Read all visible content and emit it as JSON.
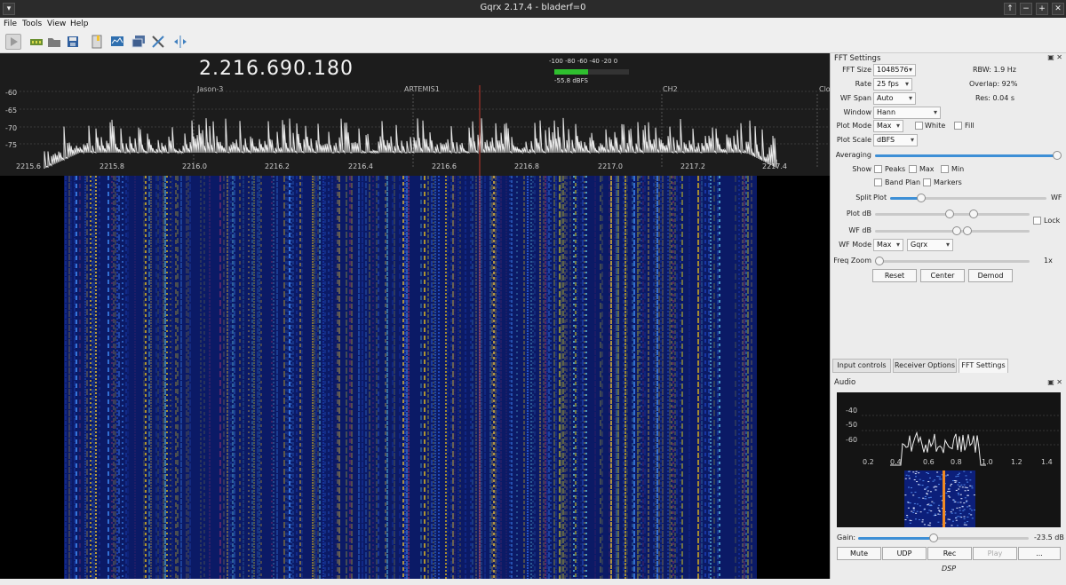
{
  "window": {
    "title": "Gqrx 2.17.4 - bladerf=0",
    "controls": [
      "↑",
      "−",
      "+",
      "✕"
    ]
  },
  "menu": [
    "File",
    "Tools",
    "View",
    "Help"
  ],
  "toolbar_icons": [
    "play-icon",
    "device-icon",
    "open-icon",
    "save-icon",
    "bookmark-icon",
    "spectrum-icon",
    "window-icon",
    "tools-icon",
    "center-icon"
  ],
  "plot": {
    "frequency": "2.216.690.180",
    "y_labels": [
      "-60",
      "-65",
      "-70",
      "-75"
    ],
    "x_labels": [
      "2215.6",
      "2215.8",
      "2216.0",
      "2216.2",
      "2216.4",
      "2216.6",
      "2216.8",
      "2217.0",
      "2217.2",
      "2217.4"
    ],
    "bookmarks": [
      "Jason-3",
      "ARTEMIS1",
      "CH2",
      "Clo"
    ],
    "meter_scale": "-100  -80  -60  -40  -20   0",
    "meter_value": "-55.8 dBFS",
    "meter_level": 0.45
  },
  "fft": {
    "panel_title": "FFT Settings",
    "fft_size_label": "FFT Size",
    "fft_size": "1048576",
    "rbw": "RBW: 1.9 Hz",
    "rate_label": "Rate",
    "rate": "25 fps",
    "overlap": "Overlap: 92%",
    "wf_span_label": "WF Span",
    "wf_span": "Auto",
    "res": "Res: 0.04 s",
    "window_label": "Window",
    "window": "Hann",
    "plot_mode_label": "Plot Mode",
    "plot_mode": "Max",
    "white": "White",
    "fill": "Fill",
    "plot_scale_label": "Plot Scale",
    "plot_scale": "dBFS",
    "averaging_label": "Averaging",
    "show_label": "Show",
    "peaks": "Peaks",
    "max": "Max",
    "min": "Min",
    "band_plan": "Band Plan",
    "markers": "Markers",
    "split_label": "Split",
    "split_plot": "Plot",
    "split_wf": "WF",
    "plot_db_label": "Plot dB",
    "lock": "Lock",
    "wf_db_label": "WF dB",
    "wf_mode_label": "WF Mode",
    "wf_mode": "Max",
    "wf_colormap": "Gqrx",
    "freq_zoom_label": "Freq Zoom",
    "freq_zoom_value": "1x",
    "reset": "Reset",
    "center": "Center",
    "demod": "Demod"
  },
  "tabs": [
    "Input controls",
    "Receiver Options",
    "FFT Settings"
  ],
  "audio": {
    "title": "Audio",
    "y_labels": [
      "-40",
      "-50",
      "-60"
    ],
    "x_labels": [
      "0.2",
      "0.4",
      "0.6",
      "0.8",
      "1.0",
      "1.2",
      "1.4"
    ],
    "gain_label": "Gain:",
    "gain_value": "-23.5 dB",
    "mute": "Mute",
    "udp": "UDP",
    "rec": "Rec",
    "play": "Play",
    "more": "...",
    "dsp": "DSP"
  }
}
